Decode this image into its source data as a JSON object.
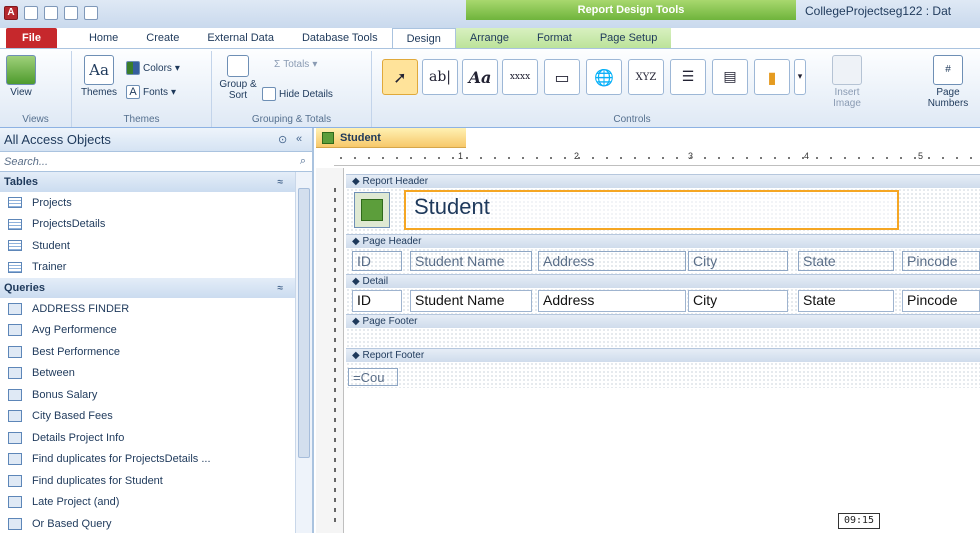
{
  "window": {
    "title": "CollegeProjectseg122 : Dat",
    "context_group": "Report Design Tools"
  },
  "tabs": [
    "File",
    "Home",
    "Create",
    "External Data",
    "Database Tools",
    "Design",
    "Arrange",
    "Format",
    "Page Setup"
  ],
  "active_tab": "Design",
  "ribbon": {
    "views": {
      "label": "Views",
      "view_btn": "View"
    },
    "themes": {
      "label": "Themes",
      "themes_btn": "Themes",
      "colors": "Colors",
      "fonts": "Fonts"
    },
    "grouping": {
      "label": "Grouping & Totals",
      "group_sort": "Group & Sort",
      "totals": "Totals",
      "hide_details": "Hide Details"
    },
    "controls": {
      "label": "Controls",
      "textbox": "ab|",
      "label_ctl": "Aa",
      "insert_image": "Insert Image",
      "page_numbers": "Page Numbers"
    }
  },
  "nav": {
    "title": "All Access Objects",
    "search_placeholder": "Search...",
    "tables_header": "Tables",
    "tables": [
      "Projects",
      "ProjectsDetails",
      "Student",
      "Trainer"
    ],
    "queries_header": "Queries",
    "queries": [
      "ADDRESS FINDER",
      "Avg Performence",
      "Best Performence",
      "Between",
      "Bonus Salary",
      "City Based Fees",
      "Details Project Info",
      "Find duplicates for ProjectsDetails ...",
      "Find duplicates for Student",
      "Late Project (and)",
      "Or Based Query"
    ]
  },
  "document": {
    "tab_label": "Student",
    "ruler_numbers": [
      "1",
      "2",
      "3",
      "4",
      "5"
    ],
    "sections": {
      "report_header": "Report Header",
      "page_header": "Page Header",
      "detail": "Detail",
      "page_footer": "Page Footer",
      "report_footer": "Report Footer"
    },
    "report_title": "Student",
    "fields": [
      "ID",
      "Student Name",
      "Address",
      "City",
      "State",
      "Pincode"
    ],
    "footer_expr": "=Cou"
  },
  "overlay_time": "09:15",
  "colors": {
    "file_tab": "#c6282c",
    "context_green": "#6fb43c",
    "doc_tab": "#f7c86a",
    "selection": "#f5a623"
  }
}
